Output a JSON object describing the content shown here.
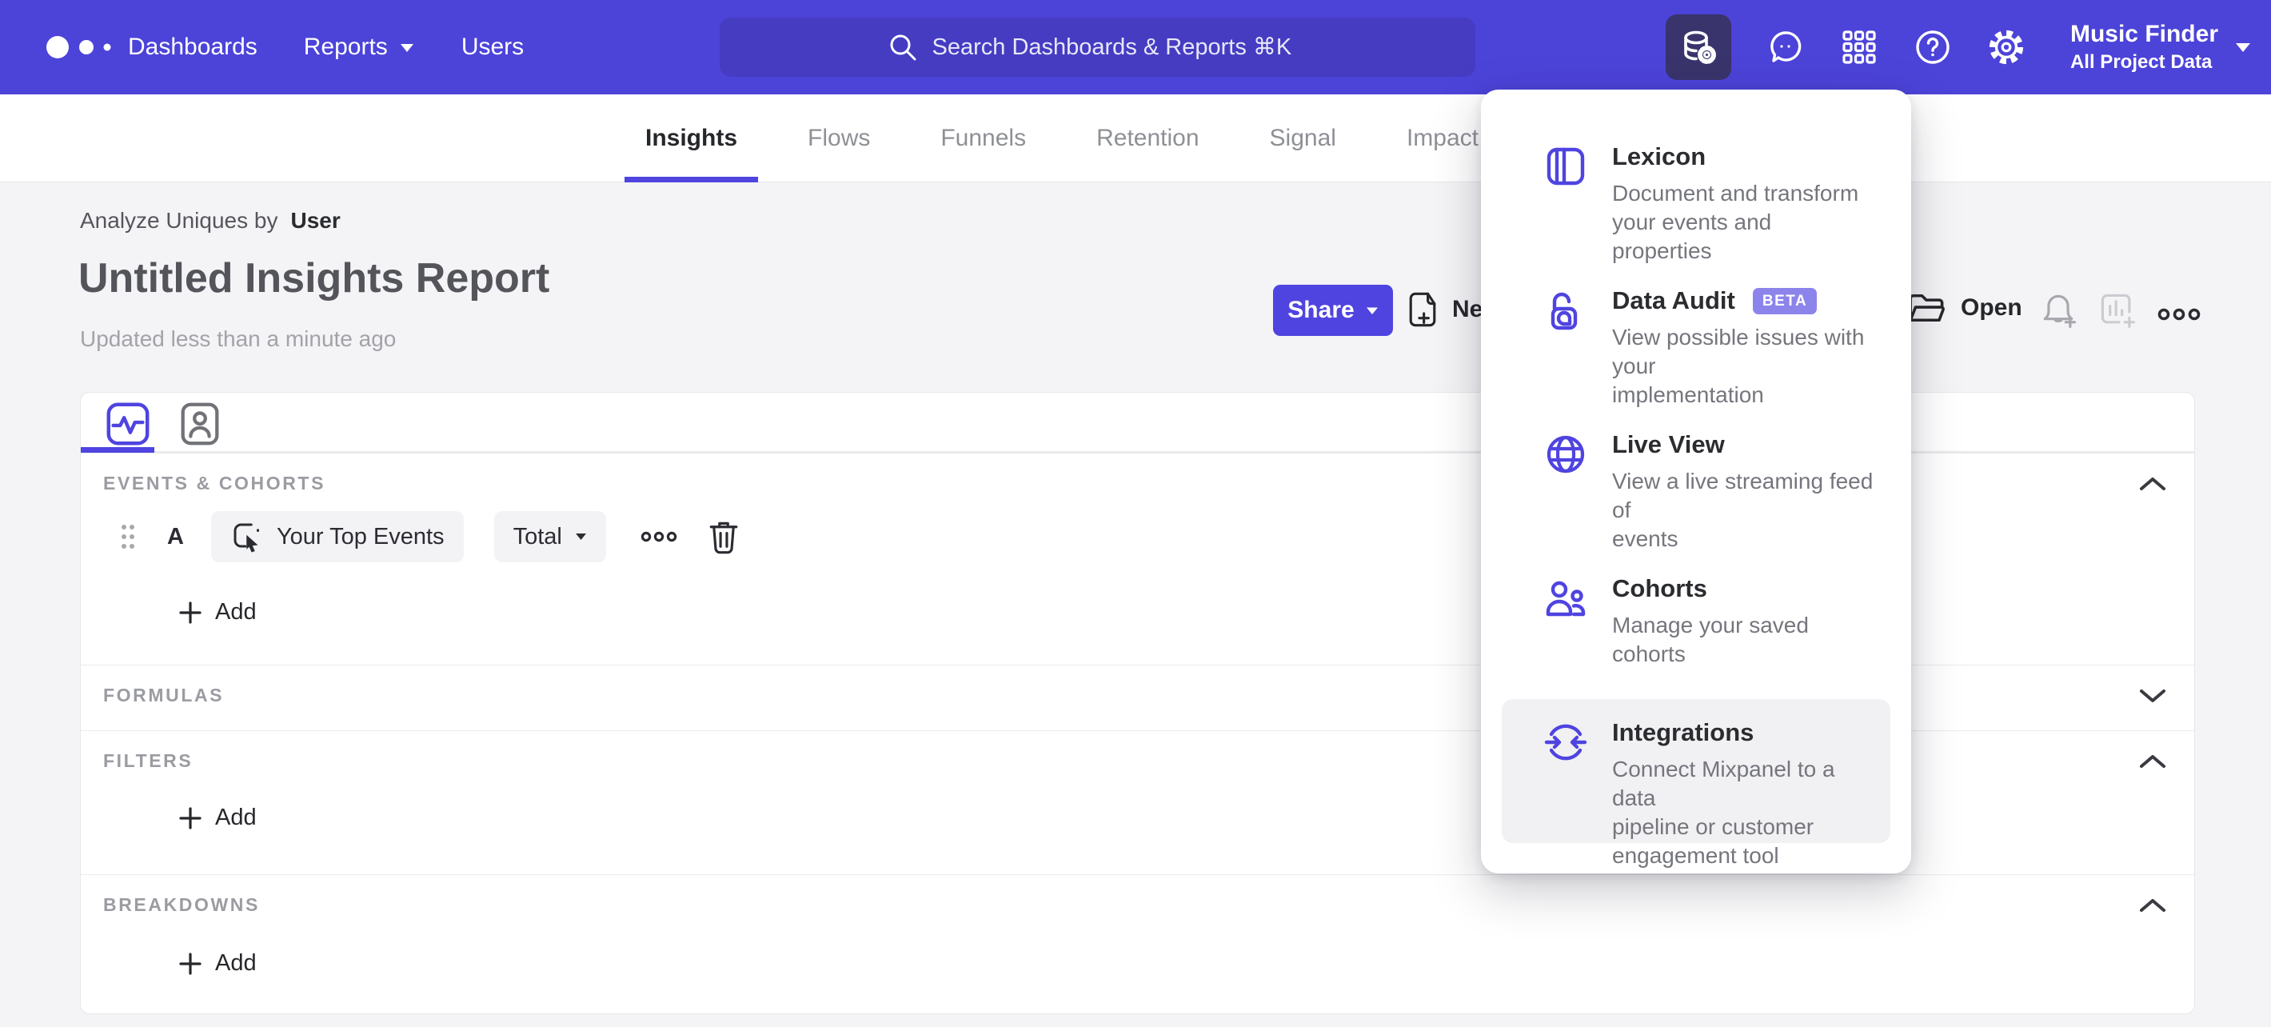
{
  "colors": {
    "accent": "#4F44E0",
    "navbar_bg": "#4C43D9",
    "search_bg": "#453CC2",
    "active_tile_bg": "#39346B",
    "page_bg": "#F4F4F6",
    "beta_badge_bg": "#8C84EA",
    "menu_highlight_bg": "#F1F1F3"
  },
  "navbar": {
    "logo_icon": "mixpanel-dots-logo",
    "items": [
      {
        "label": "Dashboards"
      },
      {
        "label": "Reports",
        "caret": true
      },
      {
        "label": "Users"
      }
    ],
    "search": {
      "icon": "search-icon",
      "placeholder": "Search Dashboards & Reports ⌘K"
    },
    "right_icons": [
      "data-management-icon",
      "messages-icon",
      "apps-grid-icon",
      "help-icon",
      "settings-icon"
    ],
    "project": {
      "name": "Music Finder",
      "scope": "All Project Data",
      "caret_icon": "caret-down-icon"
    }
  },
  "tabbar": {
    "active": "Insights",
    "tabs": [
      {
        "label": "Insights"
      },
      {
        "label": "Flows"
      },
      {
        "label": "Funnels"
      },
      {
        "label": "Retention"
      },
      {
        "label": "Signal"
      },
      {
        "label": "Impact"
      }
    ]
  },
  "report": {
    "analyze_label": "Analyze Uniques by",
    "analyze_value": "User",
    "title": "Untitled Insights Report",
    "updated": "Updated less than a minute ago"
  },
  "actions": {
    "share": "Share",
    "new": "New",
    "open": "Open",
    "icons": [
      "new-report-icon",
      "open-folder-icon",
      "alert-bell-plus-icon",
      "add-to-dashboard-icon",
      "more-options-icon"
    ]
  },
  "builder": {
    "view_tabs": [
      "metrics-view-icon",
      "profile-analysis-icon"
    ],
    "events": {
      "label": "EVENTS & COHORTS",
      "row": {
        "letter": "A",
        "event": "Your Top Events",
        "event_icon": "event-click-icon",
        "aggregation": "Total"
      },
      "add_label": "Add"
    },
    "formulas": {
      "label": "FORMULAS"
    },
    "filters": {
      "label": "FILTERS",
      "add_label": "Add"
    },
    "breakdowns": {
      "label": "BREAKDOWNS",
      "add_label": "Add"
    }
  },
  "menu": {
    "items": [
      {
        "title": "Lexicon",
        "icon": "lexicon-icon",
        "desc": "Document and transform\nyour events and properties"
      },
      {
        "title": "Data Audit",
        "icon": "data-audit-icon",
        "badge": "BETA",
        "desc": "View possible issues with your\nimplementation"
      },
      {
        "title": "Live View",
        "icon": "live-view-icon",
        "desc": "View a live streaming feed of\nevents"
      },
      {
        "title": "Cohorts",
        "icon": "cohorts-icon",
        "desc": "Manage your saved cohorts"
      },
      {
        "title": "Integrations",
        "icon": "integrations-icon",
        "desc": "Connect Mixpanel to a data\npipeline or customer\nengagement tool",
        "highlighted": true
      }
    ]
  }
}
